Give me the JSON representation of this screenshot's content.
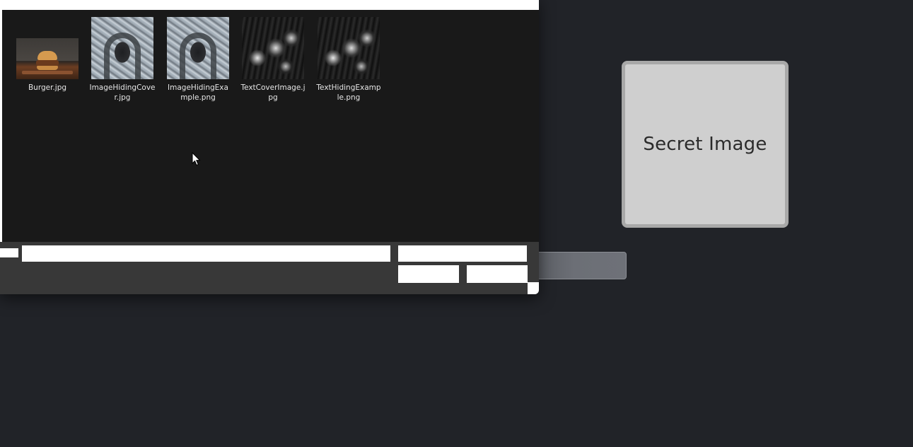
{
  "background_app": {
    "secret_card": {
      "label": "Secret Image"
    }
  },
  "file_dialog": {
    "files": [
      {
        "name": "Burger.jpg",
        "thumbnail": "burger-photo"
      },
      {
        "name": "ImageHidingCover.jpg",
        "thumbnail": "tree-arch-photo"
      },
      {
        "name": "ImageHidingExample.png",
        "thumbnail": "tree-arch-photo"
      },
      {
        "name": "TextCoverImage.jpg",
        "thumbnail": "machinery-photo"
      },
      {
        "name": "TextHidingExample.png",
        "thumbnail": "machinery-photo"
      }
    ]
  },
  "colors": {
    "page_background": "#212328",
    "dialog_background": "#191919",
    "dialog_footer": "#383838",
    "secret_card_fill": "#cfcfcf",
    "secret_card_border": "#a8a8a8",
    "file_name_text": "#e6e6e6"
  },
  "icons": {
    "cursor": "mouse-pointer-icon"
  }
}
